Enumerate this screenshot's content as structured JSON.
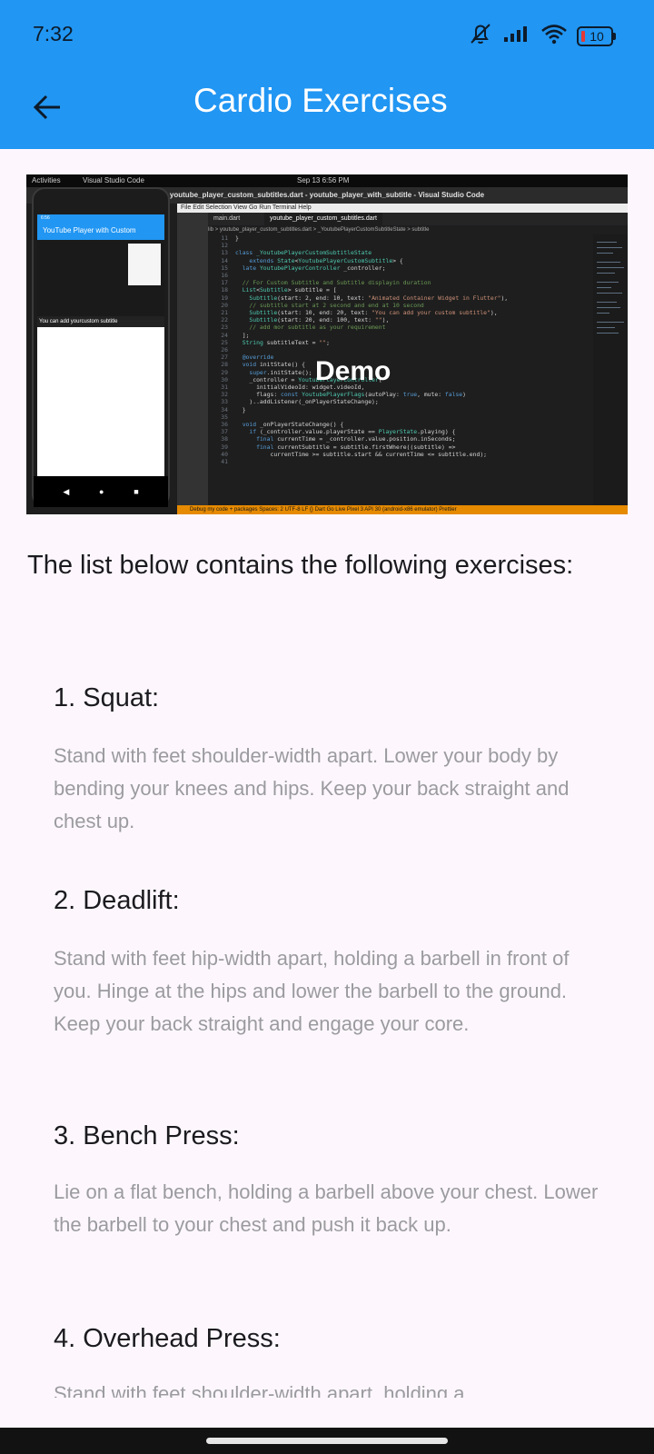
{
  "status_bar": {
    "time": "7:32",
    "battery_level": "10",
    "icons": [
      "mute-icon",
      "signal-icon",
      "wifi-icon",
      "battery-icon"
    ]
  },
  "app_bar": {
    "title": "Cardio Exercises",
    "back_icon": "arrow-left-icon",
    "color": "#2196f3"
  },
  "demo_image": {
    "label": "Demo",
    "top_bar": {
      "activities": "Activities",
      "app": "Visual Studio Code",
      "clock": "Sep 13  6:56 PM"
    },
    "window_title": "youtube_player_custom_subtitles.dart - youtube_player_with_subtitle - Visual Studio Code",
    "menu": "File  Edit  Selection  View  Go  Run  Terminal  Help",
    "tabs": [
      "main.dart",
      "youtube_player_custom_subtitles.dart"
    ],
    "breadcrumb": "lib > youtube_player_custom_subtitles.dart > _YoutubePlayerCustomSubtitleState > subtitle",
    "phone_app_title": "YouTube Player with Custom Subtitles",
    "phone_subtitle": "You can add yourcustom subtitle",
    "phone_time": "6:56",
    "status_bar_text": "Debug my code + packages   Spaces: 2  UTF-8  LF  {} Dart  Go Live  Pixel 3 API 30 (android-x86 emulator)  Prettier"
  },
  "intro": "The list below contains the following exercises:",
  "exercises": [
    {
      "title": "1. Squat:",
      "description": "Stand with feet shoulder-width apart. Lower your body by bending your knees and hips. Keep your back straight and chest up."
    },
    {
      "title": "2. Deadlift:",
      "description": "Stand with feet hip-width apart, holding a barbell in front of you. Hinge at the hips and lower the barbell to the ground. Keep your back straight and engage your core."
    },
    {
      "title": "3. Bench Press:",
      "description": "Lie on a flat bench, holding a barbell above your chest. Lower the barbell to your chest and push it back up."
    },
    {
      "title": "4. Overhead Press:",
      "description": "Stand with feet shoulder-width apart, holding a"
    }
  ]
}
